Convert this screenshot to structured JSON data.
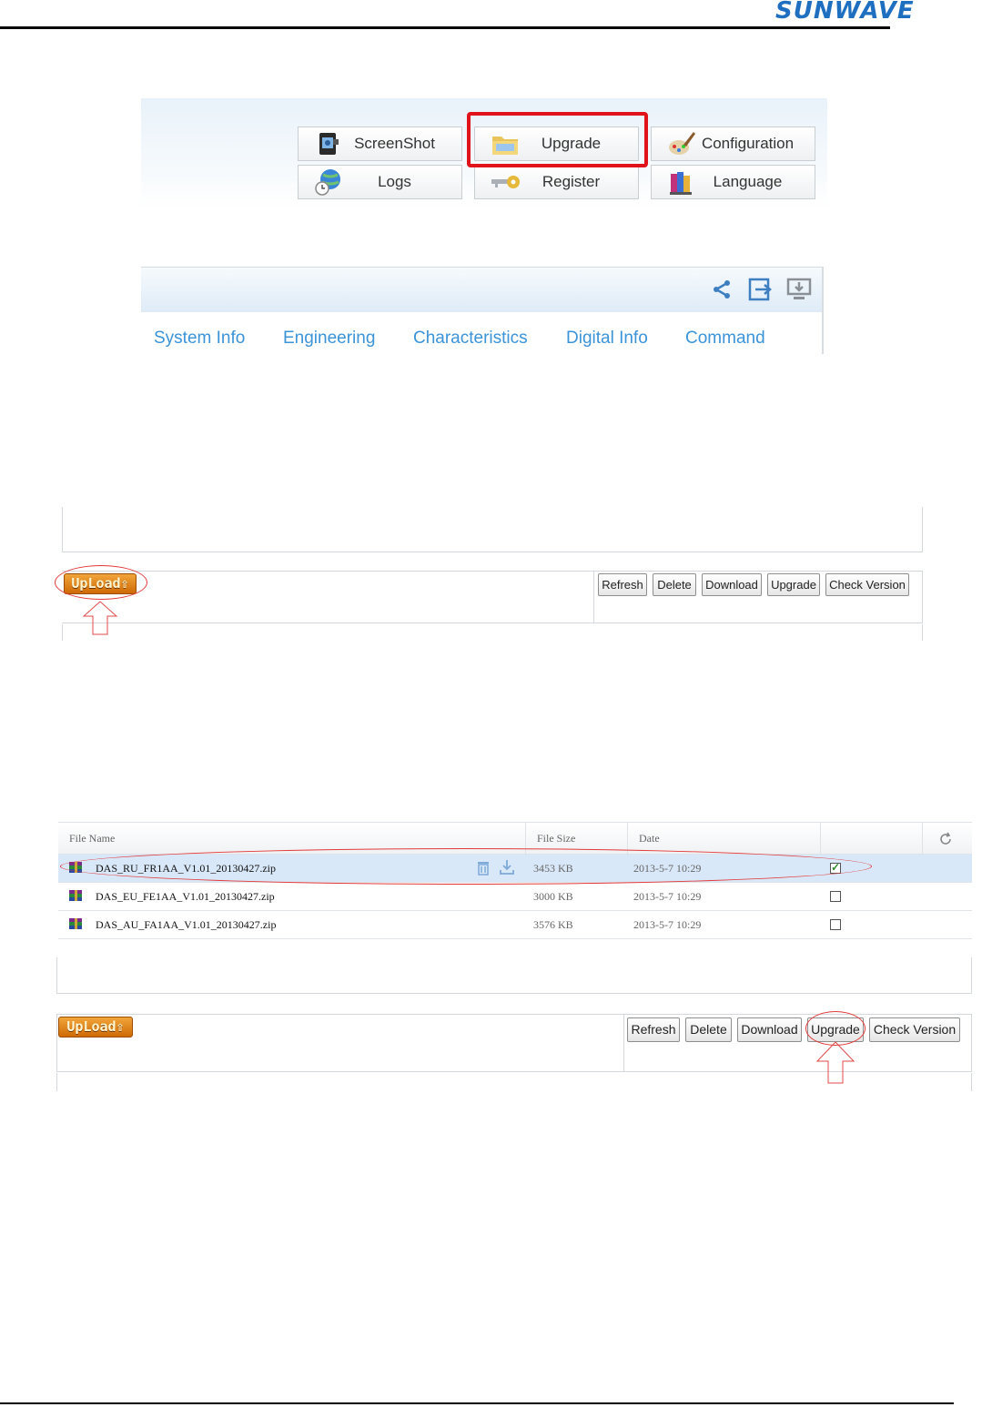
{
  "header": {
    "logo_text": "SUNWAVE",
    "colors": {
      "logo": "#1f6fc1",
      "highlight": "#e0121a",
      "nav_tab": "#3b93d8",
      "upload_button": "#e08416"
    }
  },
  "tool_menu": {
    "items": [
      {
        "label": "ScreenShot",
        "icon": "camera-icon"
      },
      {
        "label": "Upgrade",
        "icon": "folder-icon",
        "highlighted": true
      },
      {
        "label": "Configuration",
        "icon": "paint-brush-icon"
      },
      {
        "label": "Logs",
        "icon": "globe-clock-icon"
      },
      {
        "label": "Register",
        "icon": "key-icon"
      },
      {
        "label": "Language",
        "icon": "books-icon"
      }
    ]
  },
  "nav": {
    "toolbar_icons": [
      "share-icon",
      "export-icon",
      "monitor-icon"
    ],
    "tabs": [
      "System Info",
      "Engineering",
      "Characteristics",
      "Digital Info",
      "Command"
    ]
  },
  "upload_panel": {
    "upload_label": "UpLoad",
    "buttons": [
      "Refresh",
      "Delete",
      "Download",
      "Upgrade",
      "Check Version"
    ]
  },
  "file_table": {
    "columns": [
      "File Name",
      "File Size",
      "Date",
      ""
    ],
    "refresh_icon": "refresh-icon",
    "rows": [
      {
        "name": "DAS_RU_FR1AA_V1.01_20130427.zip",
        "size": "3453 KB",
        "date": "2013-5-7 10:29",
        "checked": true,
        "selected": true
      },
      {
        "name": "DAS_EU_FE1AA_V1.01_20130427.zip",
        "size": "3000 KB",
        "date": "2013-5-7 10:29",
        "checked": false,
        "selected": false
      },
      {
        "name": "DAS_AU_FA1AA_V1.01_20130427.zip",
        "size": "3576 KB",
        "date": "2013-5-7 10:29",
        "checked": false,
        "selected": false
      }
    ]
  },
  "upgrade_panel": {
    "upload_label": "UpLoad",
    "buttons": [
      "Refresh",
      "Delete",
      "Download",
      "Upgrade",
      "Check Version"
    ]
  }
}
